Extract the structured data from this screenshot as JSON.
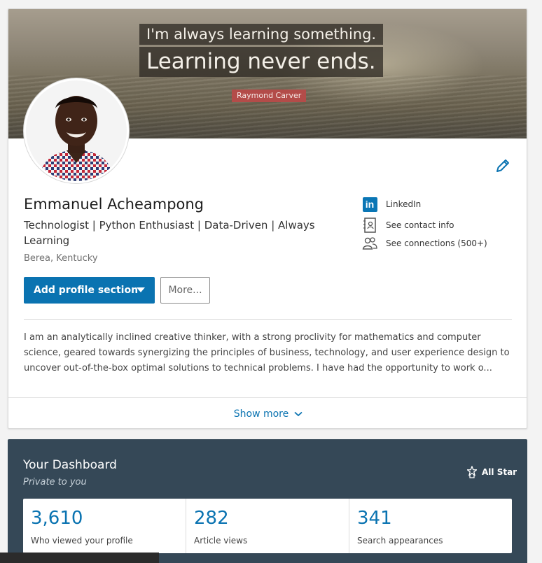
{
  "banner": {
    "quote_line1": "I'm always learning something.",
    "quote_line2": "Learning never ends.",
    "author": "Raymond Carver"
  },
  "profile": {
    "name": "Emmanuel Acheampong",
    "headline": "Technologist | Python Enthusiast | Data-Driven | Always Learning",
    "location": "Berea, Kentucky"
  },
  "contact": {
    "linkedin_label": "LinkedIn",
    "contact_info_label": "See contact info",
    "connections_label": "See connections (500+)"
  },
  "actions": {
    "add_profile_section": "Add profile section",
    "more": "More..."
  },
  "summary": {
    "line1": "I am an analytically inclined creative thinker, with a strong proclivity for mathematics and computer",
    "line2": "science, geared towards synergizing the principles of business, technology, and user experience design to",
    "line3": "uncover out-of-the-box optimal solutions to technical problems. I have had the opportunity to work o..."
  },
  "show_more": "Show more",
  "dashboard": {
    "title": "Your Dashboard",
    "subtitle": "Private to you",
    "badge": "All Star",
    "stats": [
      {
        "value": "3,610",
        "label": "Who viewed your profile"
      },
      {
        "value": "282",
        "label": "Article views"
      },
      {
        "value": "341",
        "label": "Search appearances"
      }
    ]
  },
  "colors": {
    "accent": "#0a73b1",
    "dashboard_bg": "#354857",
    "author_tag": "#b34c49"
  },
  "icons": {
    "edit": "pencil-icon",
    "linkedin": "linkedin-icon",
    "contact": "contact-card-icon",
    "connections": "people-icon",
    "show_more": "chevron-down-icon",
    "all_star": "star-icon"
  }
}
